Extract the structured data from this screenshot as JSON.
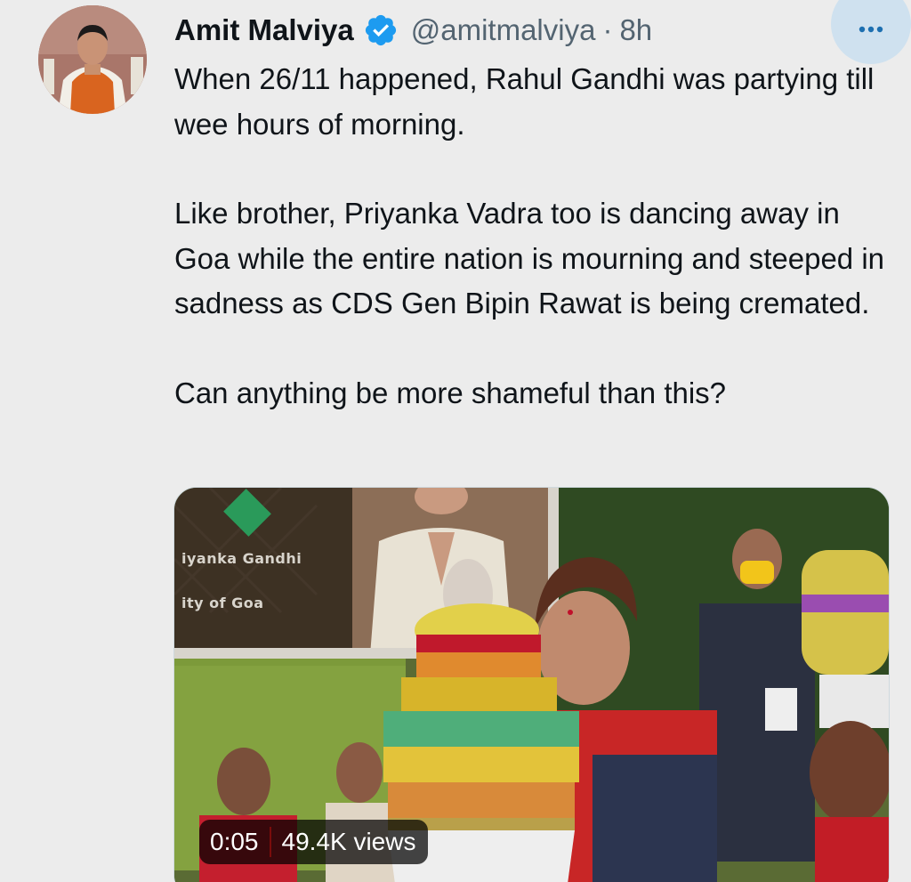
{
  "tweet": {
    "author": {
      "display_name": "Amit Malviya",
      "handle": "@amitmalviya",
      "verified_icon": "verified-badge-icon",
      "verified_color": "#1d9bf0"
    },
    "separator": "·",
    "time": "8h",
    "more_icon": "more-horizontal-icon",
    "text": {
      "paragraph_1": "When 26/11 happened, Rahul Gandhi was partying till wee hours of morning.",
      "paragraph_2": "Like brother, Priyanka Vadra too is dancing away in Goa while the entire nation is mourning and steeped in sadness as CDS Gen Bipin Rawat is being cremated.",
      "paragraph_3": "Can anything be more shameful than this?"
    },
    "media": {
      "type": "video",
      "banner_line_1": "iyanka Gandhi",
      "banner_line_2": "ity of Goa",
      "duration": "0:05",
      "views": "49.4K views"
    }
  }
}
